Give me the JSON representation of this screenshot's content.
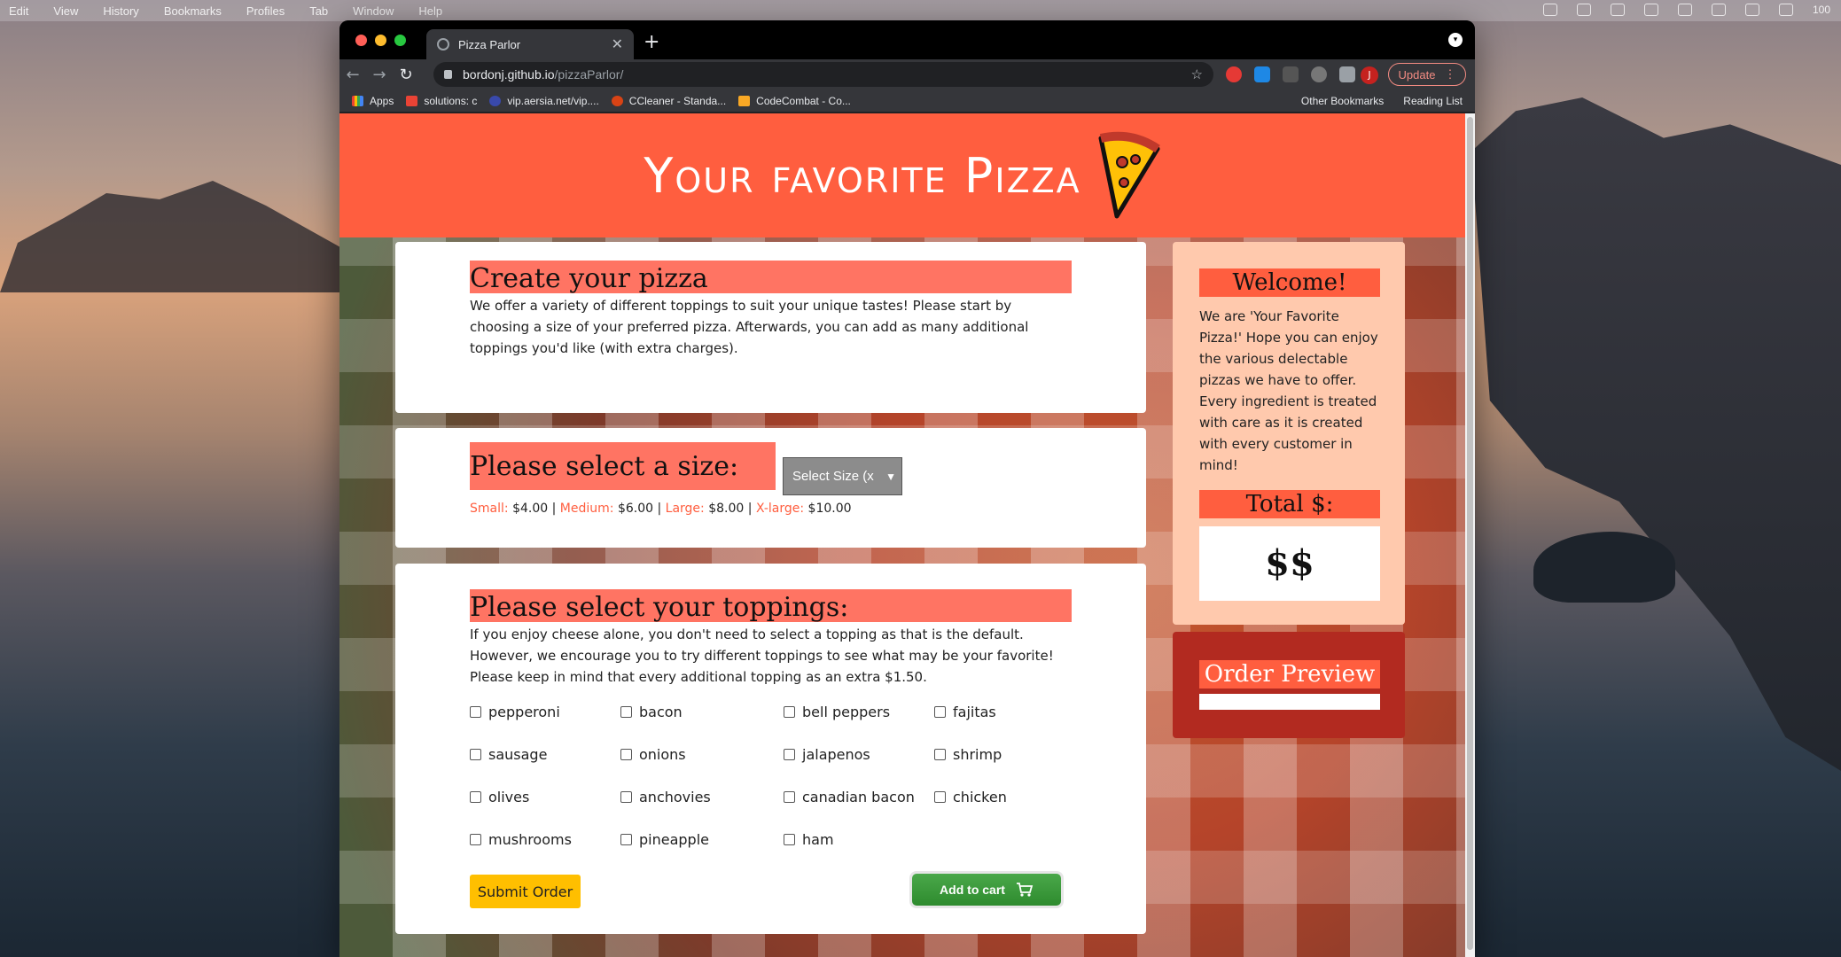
{
  "menubar": {
    "items": [
      "Edit",
      "View",
      "History",
      "Bookmarks",
      "Profiles",
      "Tab",
      "Window",
      "Help"
    ],
    "battery": "100"
  },
  "browser": {
    "tab_title": "Pizza Parlor",
    "url_host": "bordonj.github.io",
    "url_path": "/pizzaParlor/",
    "update_label": "Update",
    "avatar_initial": "J",
    "bookmarks": [
      "Apps",
      "solutions: c",
      "vip.aersia.net/vip....",
      "CCleaner - Standa...",
      "CodeCombat - Co..."
    ],
    "bookmarks_right": [
      "Other Bookmarks",
      "Reading List"
    ]
  },
  "page": {
    "header_title": "Your favorite Pizza",
    "create": {
      "title": "Create your pizza",
      "text": "We offer a variety of different toppings to suit your unique tastes! Please start by choosing a size of your preferred pizza. Afterwards, you can add as many additional toppings you'd like (with extra charges)."
    },
    "size": {
      "title": "Please select a size:",
      "select_value": "Select Size (x",
      "prices": [
        {
          "label": "Small:",
          "price": "$4.00"
        },
        {
          "label": "Medium:",
          "price": "$6.00"
        },
        {
          "label": "Large:",
          "price": "$8.00"
        },
        {
          "label": "X-large:",
          "price": "$10.00"
        }
      ]
    },
    "toppings": {
      "title": "Please select your toppings:",
      "text": "If you enjoy cheese alone, you don't need to select a topping as that is the default. However, we encourage you to try different toppings to see what may be your favorite! Please keep in mind that every additional topping as an extra $1.50.",
      "items": [
        "pepperoni",
        "bacon",
        "bell peppers",
        "fajitas",
        "sausage",
        "onions",
        "jalapenos",
        "shrimp",
        "olives",
        "anchovies",
        "canadian bacon",
        "chicken",
        "mushrooms",
        "pineapple",
        "ham"
      ],
      "submit_label": "Submit Order",
      "cart_label": "Add to cart"
    },
    "welcome": {
      "title": "Welcome!",
      "text": "We are 'Your Favorite Pizza!' Hope you can enjoy the various delectable pizzas we have to offer. Every ingredient is treated with care as it is created with every customer in mind!",
      "total_title": "Total $:",
      "total_value": "$$"
    },
    "preview": {
      "title": "Order Preview"
    }
  },
  "colors": {
    "header": "#ff5e3f",
    "title_band": "#ff7463",
    "sidebar": "#ffc9ad",
    "preview_panel": "#b22a20",
    "submit": "#ffbf00",
    "cart": "#2e8b2e"
  }
}
